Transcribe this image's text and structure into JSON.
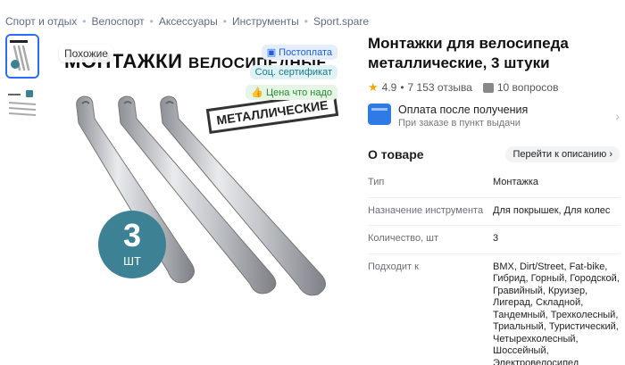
{
  "breadcrumbs": [
    "Спорт и отдых",
    "Велоспорт",
    "Аксессуары",
    "Инструменты",
    "Sport.spare"
  ],
  "gallery": {
    "similar_label": "Похожие",
    "image_title_big": "МОНТАЖКИ",
    "image_title_small": "ВЕЛОСИПЕДНЫЕ",
    "stamp_text": "МЕТАЛЛИЧЕСКИЕ",
    "qty_number": "3",
    "qty_unit": "ШТ",
    "badges": {
      "postpay": "Постоплата",
      "certificate": "Соц. сертификат",
      "price": "Цена что надо"
    }
  },
  "product": {
    "title": "Монтажки для велосипеда металлические, 3 штуки",
    "rating": "4.9",
    "reviews": "7 153 отзыва",
    "questions": "10 вопросов"
  },
  "payment": {
    "title": "Оплата после получения",
    "subtitle": "При заказе в пункт выдачи"
  },
  "about": {
    "title": "О товаре",
    "goto_label": "Перейти к описанию"
  },
  "specs": [
    {
      "key": "Тип",
      "value": "Монтажка"
    },
    {
      "key": "Назначение инструмента",
      "value": "Для покрышек, Для колес"
    },
    {
      "key": "Количество, шт",
      "value": "3"
    },
    {
      "key": "Подходит к",
      "value": "BMX, Dirt/Street, Fat-bike, Гибрид, Горный, Городской, Гравийный, Круизер, Лигерад, Складной, Тандемный, Трехколесный, Триальный, Туристический, Четырехколесный, Шоссейный, Электровелосипед"
    }
  ],
  "colors": {
    "accent": "#2b6df2",
    "qty_circle": "#3d8294",
    "star": "#f6a609"
  }
}
